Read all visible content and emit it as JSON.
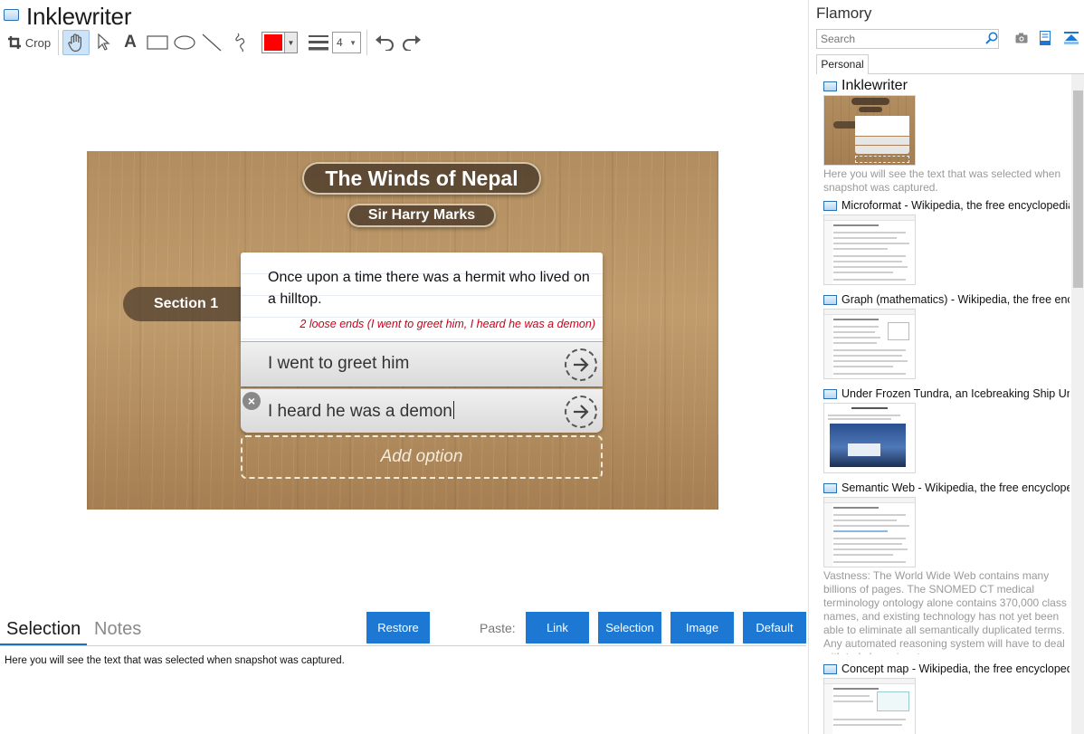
{
  "app": {
    "title": "Inklewriter"
  },
  "toolbar": {
    "crop_label": "Crop",
    "tools": [
      "hand-tool-icon",
      "pointer-tool-icon",
      "text-tool-icon",
      "rectangle-tool-icon",
      "ellipse-tool-icon",
      "line-tool-icon",
      "freehand-tool-icon"
    ],
    "text_tool_glyph": "A",
    "active_tool": "hand-tool-icon",
    "color": "#ff0000",
    "line_width": "4",
    "history": [
      "undo-icon",
      "redo-icon"
    ]
  },
  "snapshot": {
    "story_title": "The Winds of Nepal",
    "author": "Sir Harry Marks",
    "section": "Section 1",
    "paragraph": "Once upon a time there was a hermit who lived on a hilltop.",
    "loose_ends": "2 loose ends (I went to greet him, I heard he was a demon)",
    "options": [
      {
        "text": "I went to greet him"
      },
      {
        "text": "I heard he was a demon"
      }
    ],
    "delete_glyph": "×",
    "add_option": "Add option"
  },
  "bottom": {
    "tabs": [
      "Selection",
      "Notes"
    ],
    "active_tab": "Selection",
    "restore_label": "Restore",
    "paste_label": "Paste:",
    "paste_buttons": [
      "Link",
      "Selection",
      "Image",
      "Default"
    ],
    "selection_text": "Here you will see the text that was selected when snapshot was captured.",
    "accent": "#1c78d2"
  },
  "sidebar": {
    "title": "Flamory",
    "search_placeholder": "Search",
    "tab": "Personal",
    "items": [
      {
        "title": "Inklewriter",
        "desc": "Here you will see the text that was selected when snapshot was captured."
      },
      {
        "title": "Microformat - Wikipedia, the free encyclopedia",
        "desc": ""
      },
      {
        "title": "Graph (mathematics) - Wikipedia, the free ency",
        "desc": ""
      },
      {
        "title": "Under Frozen Tundra, an Icebreaking Ship Unco",
        "desc": ""
      },
      {
        "title": "Semantic Web - Wikipedia, the free encycloped",
        "desc": "Vastness: The World Wide Web contains many billions of pages. The SNOMED CT medical terminology ontology alone contains 370,000 class names, and existing technology has not yet been able to eliminate all semantically duplicated terms. Any automated reasoning system will have to deal with truly huge inputs."
      },
      {
        "title": "Concept map - Wikipedia, the free encyclopedi",
        "desc": ""
      }
    ]
  }
}
